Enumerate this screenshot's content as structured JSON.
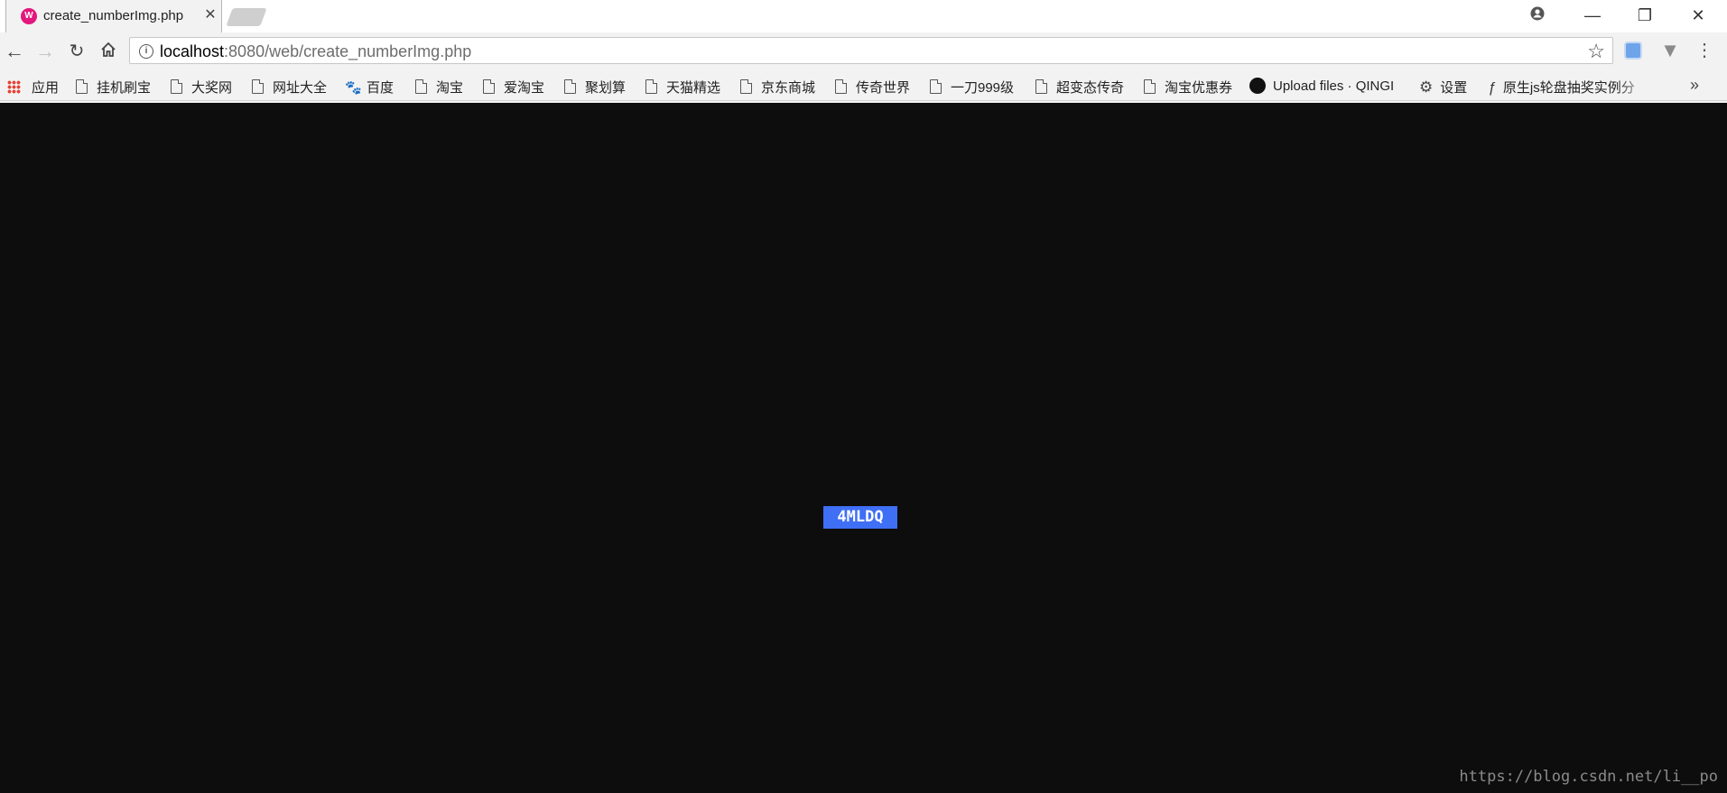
{
  "tab": {
    "title": "create_numberImg.php",
    "favicon": "php-icon"
  },
  "window": {
    "controls": [
      "account-icon",
      "minimize-icon",
      "restore-icon",
      "close-icon"
    ]
  },
  "address": {
    "host": "localhost",
    "rest": ":8080/web/create_numberImg.php"
  },
  "bookmarks": {
    "apps": "应用",
    "items": [
      "挂机刷宝",
      "大奖网",
      "网址大全",
      "百度",
      "淘宝",
      "爱淘宝",
      "聚划算",
      "天猫精选",
      "京东商城",
      "传奇世界",
      "一刀999级",
      "超变态传奇",
      "淘宝优惠券",
      "Upload files · QINGI",
      "设置",
      "原生js轮盘抽奖实例分"
    ],
    "more": "»"
  },
  "page": {
    "captcha_text": "4MLDQ",
    "captcha_bg": "#3f6ff5",
    "background": "#0d0d0d"
  },
  "watermark": "https://blog.csdn.net/li__po"
}
